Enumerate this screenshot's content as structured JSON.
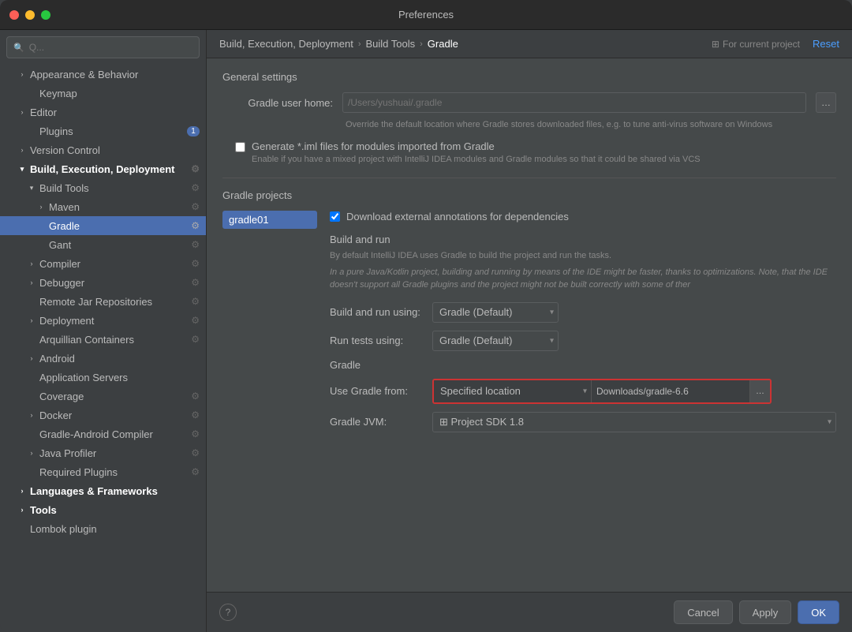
{
  "window": {
    "title": "Preferences"
  },
  "breadcrumb": {
    "path1": "Build, Execution, Deployment",
    "sep1": "›",
    "path2": "Build Tools",
    "sep2": "›",
    "path3": "Gradle",
    "project_icon": "⊞",
    "project_label": "For current project",
    "reset_label": "Reset"
  },
  "search": {
    "placeholder": "Q..."
  },
  "sidebar": {
    "items": [
      {
        "id": "appearance",
        "label": "Appearance & Behavior",
        "indent": "indent-1",
        "expanded": false,
        "bold": true,
        "arrow": "›"
      },
      {
        "id": "keymap",
        "label": "Keymap",
        "indent": "indent-2",
        "expanded": false,
        "bold": false,
        "arrow": ""
      },
      {
        "id": "editor",
        "label": "Editor",
        "indent": "indent-1",
        "expanded": false,
        "bold": true,
        "arrow": "›"
      },
      {
        "id": "plugins",
        "label": "Plugins",
        "indent": "indent-2",
        "expanded": false,
        "bold": false,
        "arrow": "",
        "badge": "1"
      },
      {
        "id": "version-control",
        "label": "Version Control",
        "indent": "indent-1",
        "expanded": false,
        "bold": true,
        "arrow": "›"
      },
      {
        "id": "build-exec",
        "label": "Build, Execution, Deployment",
        "indent": "indent-1",
        "expanded": true,
        "bold": true,
        "arrow": "▾"
      },
      {
        "id": "build-tools",
        "label": "Build Tools",
        "indent": "indent-2",
        "expanded": true,
        "arrow": "▾"
      },
      {
        "id": "maven",
        "label": "Maven",
        "indent": "indent-3",
        "expanded": false,
        "arrow": "›"
      },
      {
        "id": "gradle",
        "label": "Gradle",
        "indent": "indent-3",
        "selected": true,
        "arrow": ""
      },
      {
        "id": "gant",
        "label": "Gant",
        "indent": "indent-3",
        "arrow": ""
      },
      {
        "id": "compiler",
        "label": "Compiler",
        "indent": "indent-2",
        "arrow": "›"
      },
      {
        "id": "debugger",
        "label": "Debugger",
        "indent": "indent-2",
        "arrow": "›"
      },
      {
        "id": "remote-jar",
        "label": "Remote Jar Repositories",
        "indent": "indent-2",
        "arrow": ""
      },
      {
        "id": "deployment",
        "label": "Deployment",
        "indent": "indent-2",
        "arrow": "›"
      },
      {
        "id": "arquillian",
        "label": "Arquillian Containers",
        "indent": "indent-2",
        "arrow": ""
      },
      {
        "id": "android",
        "label": "Android",
        "indent": "indent-2",
        "arrow": "›"
      },
      {
        "id": "app-servers",
        "label": "Application Servers",
        "indent": "indent-2",
        "arrow": ""
      },
      {
        "id": "coverage",
        "label": "Coverage",
        "indent": "indent-2",
        "arrow": ""
      },
      {
        "id": "docker",
        "label": "Docker",
        "indent": "indent-2",
        "arrow": "›"
      },
      {
        "id": "gradle-android",
        "label": "Gradle-Android Compiler",
        "indent": "indent-2",
        "arrow": ""
      },
      {
        "id": "java-profiler",
        "label": "Java Profiler",
        "indent": "indent-2",
        "arrow": "›"
      },
      {
        "id": "required-plugins",
        "label": "Required Plugins",
        "indent": "indent-2",
        "arrow": ""
      },
      {
        "id": "languages",
        "label": "Languages & Frameworks",
        "indent": "indent-1",
        "bold": true,
        "arrow": "›"
      },
      {
        "id": "tools",
        "label": "Tools",
        "indent": "indent-1",
        "bold": true,
        "arrow": "›"
      },
      {
        "id": "lombok",
        "label": "Lombok plugin",
        "indent": "indent-1",
        "arrow": ""
      }
    ]
  },
  "content": {
    "general_settings_title": "General settings",
    "gradle_user_home_label": "Gradle user home:",
    "gradle_user_home_placeholder": "/Users/yushuai/.gradle",
    "gradle_user_home_hint": "Override the default location where Gradle stores downloaded files, e.g. to tune anti-virus software on Windows",
    "generate_iml_label": "Generate *.iml files for modules imported from Gradle",
    "generate_iml_hint": "Enable if you have a mixed project with IntelliJ IDEA modules and Gradle modules so that it could be shared via VCS",
    "gradle_projects_title": "Gradle projects",
    "project_item": "gradle01",
    "download_annotations_label": "Download external annotations for dependencies",
    "build_run_title": "Build and run",
    "build_run_hint1": "By default IntelliJ IDEA uses Gradle to build the project and run the tasks.",
    "build_run_hint2": "In a pure Java/Kotlin project, building and running by means of the IDE might be faster, thanks to optimizations. Note, that the IDE doesn't support all Gradle plugins and the project might not be built correctly with some of ther",
    "build_run_using_label": "Build and run using:",
    "build_run_using_value": "Gradle (Default)",
    "run_tests_using_label": "Run tests using:",
    "run_tests_using_value": "Gradle (Default)",
    "gradle_section_label": "Gradle",
    "use_gradle_from_label": "Use Gradle from:",
    "use_gradle_from_value": "Specified location",
    "gradle_path_value": "Downloads/gradle-6.6",
    "gradle_jvm_label": "Gradle JVM:",
    "gradle_jvm_icon": "⊞",
    "gradle_jvm_value": "Project SDK 1.8",
    "buttons": {
      "cancel": "Cancel",
      "apply": "Apply",
      "ok": "OK"
    }
  }
}
